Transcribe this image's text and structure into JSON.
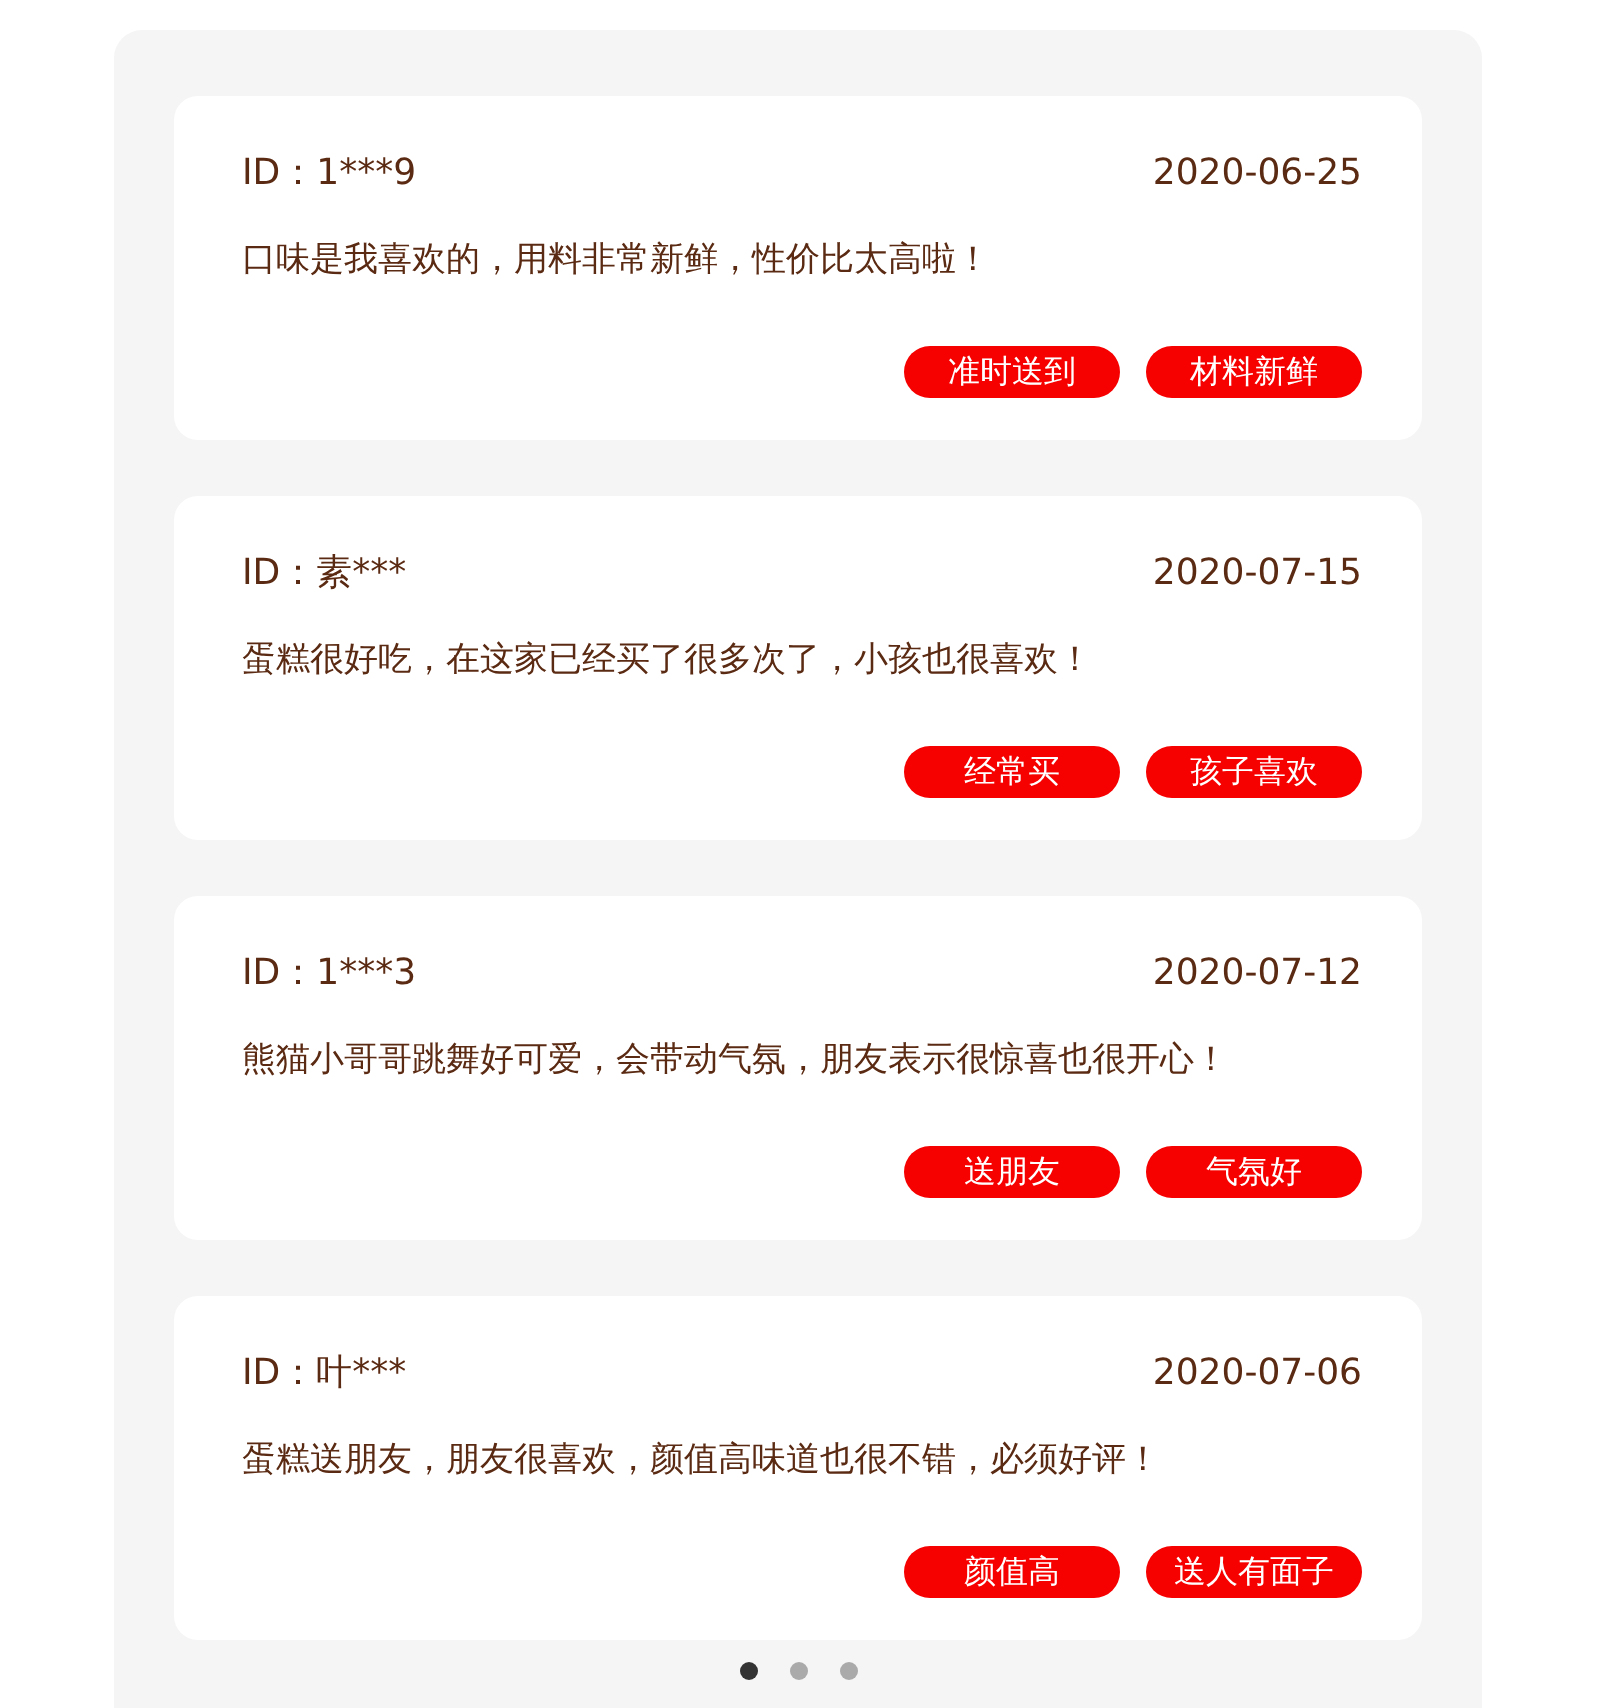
{
  "reviews": [
    {
      "user_id": "ID：1***9",
      "date": "2020-06-25",
      "comment": "口味是我喜欢的，用料非常新鲜，性价比太高啦！",
      "tags": [
        "准时送到",
        "材料新鲜"
      ]
    },
    {
      "user_id": "ID：素***",
      "date": "2020-07-15",
      "comment": "蛋糕很好吃，在这家已经买了很多次了，小孩也很喜欢！",
      "tags": [
        "经常买",
        "孩子喜欢"
      ]
    },
    {
      "user_id": "ID：1***3",
      "date": "2020-07-12",
      "comment": "熊猫小哥哥跳舞好可爱，会带动气氛，朋友表示很惊喜也很开心！",
      "tags": [
        "送朋友",
        "气氛好"
      ]
    },
    {
      "user_id": "ID：叶***",
      "date": "2020-07-06",
      "comment": "蛋糕送朋友，朋友很喜欢，颜值高味道也很不错，必须好评！",
      "tags": [
        "颜值高",
        "送人有面子"
      ]
    }
  ],
  "pager": [
    {
      "selected": true
    },
    {
      "selected": false
    },
    {
      "selected": false
    }
  ]
}
